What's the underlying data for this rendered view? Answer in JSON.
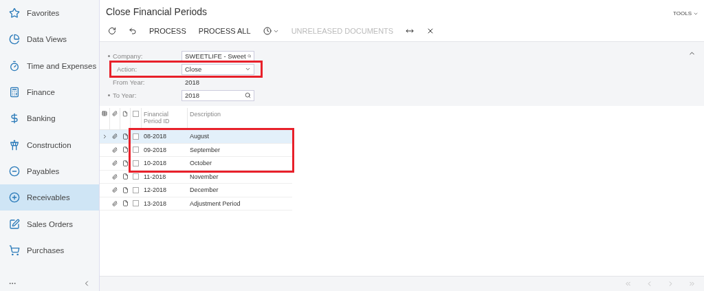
{
  "sidebar": {
    "items": [
      {
        "label": "Favorites",
        "selected": false
      },
      {
        "label": "Data Views",
        "selected": false
      },
      {
        "label": "Time and Expenses",
        "selected": false
      },
      {
        "label": "Finance",
        "selected": false
      },
      {
        "label": "Banking",
        "selected": false
      },
      {
        "label": "Construction",
        "selected": false
      },
      {
        "label": "Payables",
        "selected": false
      },
      {
        "label": "Receivables",
        "selected": true
      },
      {
        "label": "Sales Orders",
        "selected": false
      },
      {
        "label": "Purchases",
        "selected": false
      }
    ]
  },
  "title": "Close Financial Periods",
  "tools": "TOOLS",
  "toolbar": [
    {
      "kind": "icon",
      "disabled": false
    },
    {
      "kind": "icon",
      "disabled": false
    },
    {
      "kind": "text",
      "label": "PROCESS",
      "disabled": false
    },
    {
      "kind": "text",
      "label": "PROCESS ALL",
      "disabled": false
    },
    {
      "kind": "menu",
      "disabled": false
    },
    {
      "kind": "text",
      "label": "UNRELEASED DOCUMENTS",
      "disabled": true
    },
    {
      "kind": "icon",
      "disabled": false
    },
    {
      "kind": "icon",
      "disabled": false
    }
  ],
  "filters": [
    {
      "label": "Company:",
      "required": true,
      "kind": "lookup",
      "value": "SWEETLIFE - Sweet",
      "highlighted": false
    },
    {
      "label": "Action:",
      "required": false,
      "kind": "select",
      "value": "Close",
      "highlighted": true
    },
    {
      "label": "From Year:",
      "required": false,
      "kind": "readonly",
      "value": "2018",
      "highlighted": false
    },
    {
      "label": "To Year:",
      "required": true,
      "kind": "lookup",
      "value": "2018",
      "highlighted": false
    }
  ],
  "table": {
    "all_checked": false,
    "columns": [
      "Financial Period ID",
      "Description"
    ],
    "rows": [
      {
        "period": "08-2018",
        "description": "August",
        "selected": true,
        "checked": false,
        "highlighted": true
      },
      {
        "period": "09-2018",
        "description": "September",
        "selected": false,
        "checked": false,
        "highlighted": true
      },
      {
        "period": "10-2018",
        "description": "October",
        "selected": false,
        "checked": false,
        "highlighted": true
      },
      {
        "period": "11-2018",
        "description": "November",
        "selected": false,
        "checked": false,
        "highlighted": false
      },
      {
        "period": "12-2018",
        "description": "December",
        "selected": false,
        "checked": false,
        "highlighted": false
      },
      {
        "period": "13-2018",
        "description": "Adjustment Period",
        "selected": false,
        "checked": false,
        "highlighted": false
      }
    ]
  }
}
